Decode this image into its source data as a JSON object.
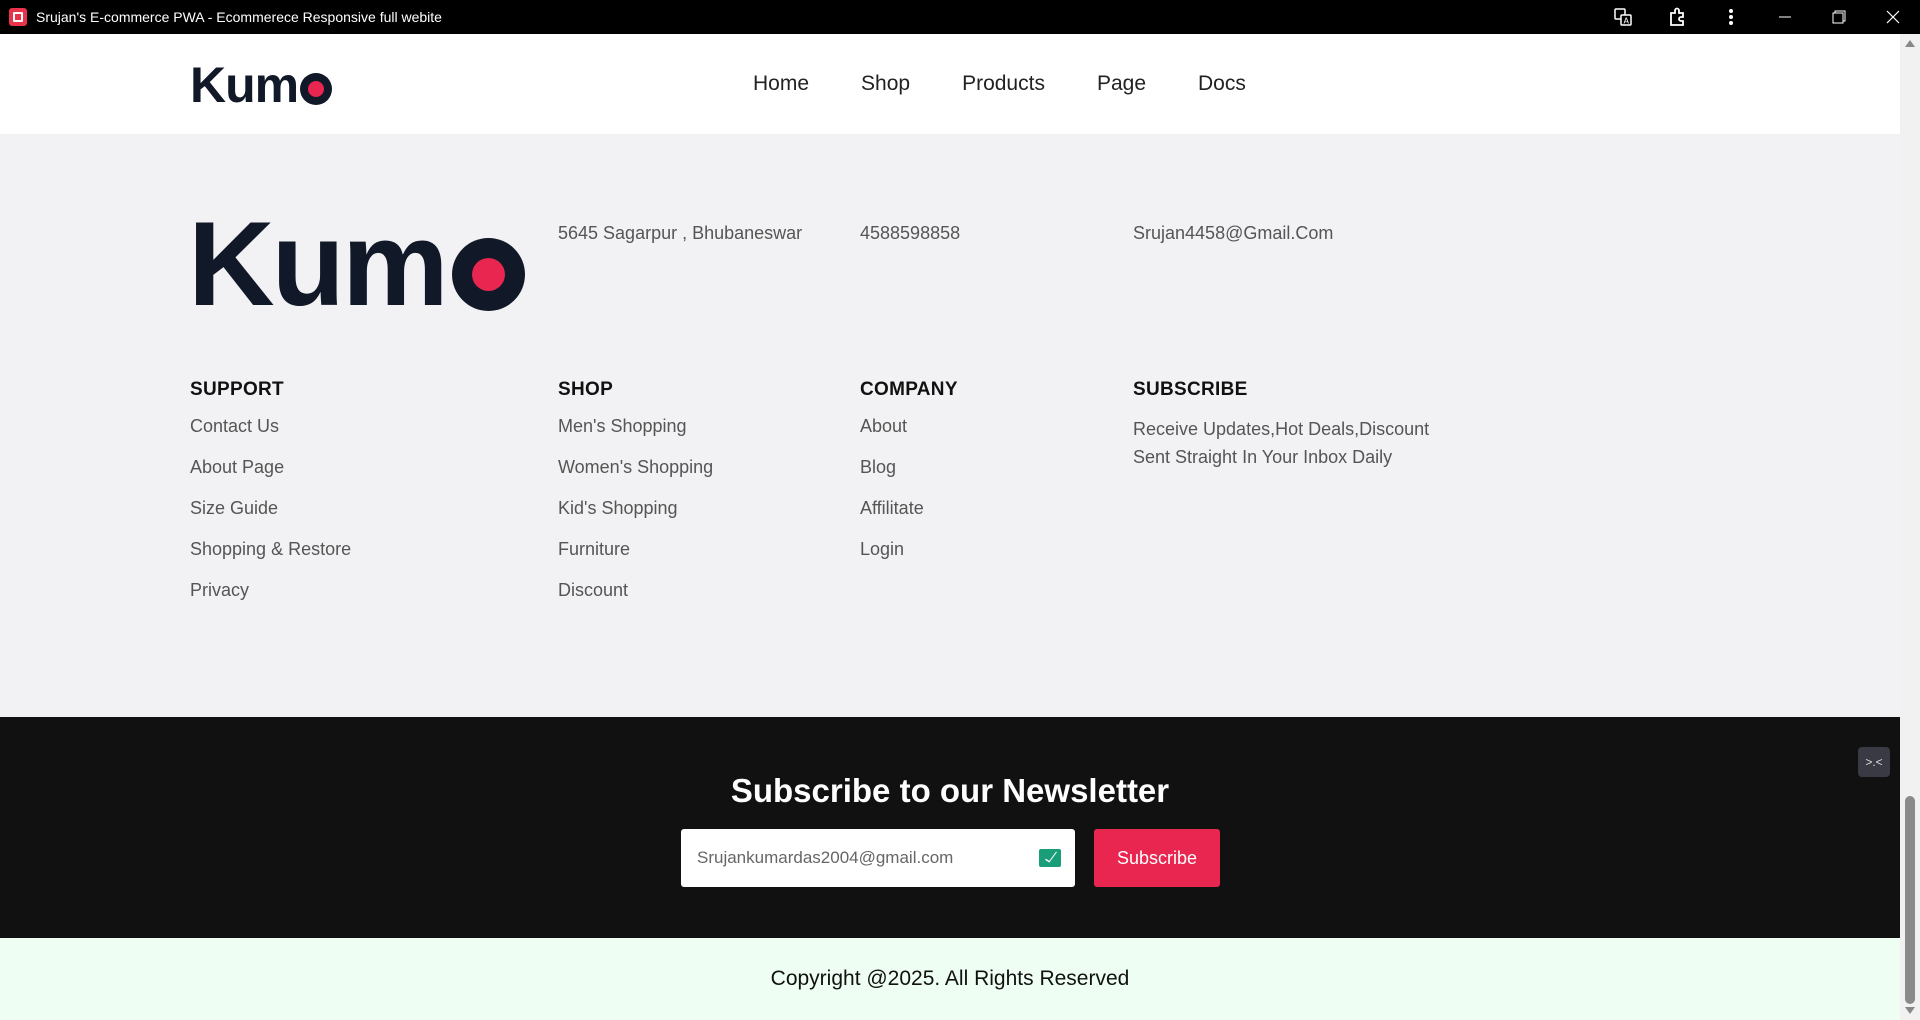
{
  "window": {
    "title": "Srujan's E-commerce PWA - Ecommerece Responsive full webite",
    "icons": [
      "app-icon",
      "translate-icon",
      "extensions-icon",
      "more-icon",
      "minimize-icon",
      "restore-icon",
      "close-icon"
    ]
  },
  "navbar": {
    "logo": "Kum",
    "links": [
      "Home",
      "Shop",
      "Products",
      "Page",
      "Docs"
    ]
  },
  "footer": {
    "logo": "Kum",
    "address": "5645 Sagarpur , Bhubaneswar",
    "phone": "4588598858",
    "email": "Srujan4458@Gmail.Com",
    "support": {
      "heading": "SUPPORT",
      "links": [
        "Contact Us",
        "About Page",
        "Size Guide",
        "Shopping & Restore",
        "Privacy"
      ]
    },
    "shop": {
      "heading": "SHOP",
      "links": [
        "Men's Shopping",
        "Women's Shopping",
        "Kid's Shopping",
        "Furniture",
        "Discount"
      ]
    },
    "company": {
      "heading": "COMPANY",
      "links": [
        "About",
        "Blog",
        "Affilitate",
        "Login"
      ]
    },
    "subscribe": {
      "heading": "SUBSCRIBE",
      "line1": "Receive Updates,Hot Deals,Discount",
      "line2": "Sent Straight In Your Inbox Daily"
    }
  },
  "newsletter": {
    "title": "Subscribe to our Newsletter",
    "email_value": "Srujankumardas2004@gmail.com",
    "button_label": "Subscribe",
    "badge": ">.<"
  },
  "copyright": "Copyright @2025. All Rights Reserved",
  "colors": {
    "accent": "#e8264f",
    "dark": "#111827",
    "newsletter_bg": "#111111",
    "copyright_bg": "#effef3"
  }
}
